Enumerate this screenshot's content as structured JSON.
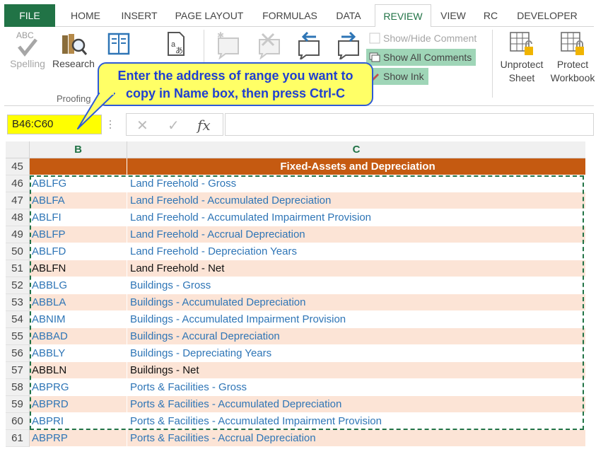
{
  "tabs": [
    {
      "label": "FILE",
      "x": 0
    },
    {
      "label": "HOME"
    },
    {
      "label": "INSERT"
    },
    {
      "label": "PAGE LAYOUT"
    },
    {
      "label": "FORMULAS"
    },
    {
      "label": "DATA"
    },
    {
      "label": "REVIEW"
    },
    {
      "label": "VIEW"
    },
    {
      "label": "RC"
    },
    {
      "label": "DEVELOPER"
    }
  ],
  "ribbon": {
    "spelling_label": "Spelling",
    "research_label": "Research",
    "proofing_group": "Proofing",
    "show_hide_comment": "Show/Hide Comment",
    "show_all_comments": "Show All Comments",
    "show_ink": "Show Ink",
    "unprotect_sheet_line1": "Unprotect",
    "unprotect_sheet_line2": "Sheet",
    "protect_workbook_line1": "Protect",
    "protect_workbook_line2": "Workbook",
    "abc_glyph": "ABC"
  },
  "callout": {
    "line1": "Enter the address of range you want to",
    "line2": "copy in Name box, then press Ctrl-C"
  },
  "formula_bar": {
    "name_box": "B46:C60",
    "fx": "fx",
    "cancel": "✕",
    "enter": "✓"
  },
  "columns": {
    "b": "B",
    "c": "C"
  },
  "rows": [
    {
      "num": "45",
      "b": "",
      "c": "Fixed-Assets and Depreciation",
      "style": "header"
    },
    {
      "num": "46",
      "b": "ABLFG",
      "c": "Land Freehold - Gross",
      "color": "blue"
    },
    {
      "num": "47",
      "b": "ABLFA",
      "c": "Land Freehold - Accumulated Depreciation",
      "color": "blue"
    },
    {
      "num": "48",
      "b": "ABLFI",
      "c": "Land Freehold - Accumulated Impairment Provision",
      "color": "blue"
    },
    {
      "num": "49",
      "b": "ABLFP",
      "c": "Land Freehold - Accrual Depreciation",
      "color": "blue"
    },
    {
      "num": "50",
      "b": "ABLFD",
      "c": "Land Freehold - Depreciation Years",
      "color": "blue"
    },
    {
      "num": "51",
      "b": "ABLFN",
      "c": "Land Freehold - Net",
      "color": "black"
    },
    {
      "num": "52",
      "b": "ABBLG",
      "c": "Buildings - Gross",
      "color": "blue"
    },
    {
      "num": "53",
      "b": "ABBLA",
      "c": "Buildings - Accumulated Depreciation",
      "color": "blue"
    },
    {
      "num": "54",
      "b": "ABNIM",
      "c": "Buildings - Accumulated Impairment Provision",
      "color": "blue"
    },
    {
      "num": "55",
      "b": "ABBAD",
      "c": "Buildings - Accural Depreciation",
      "color": "blue"
    },
    {
      "num": "56",
      "b": "ABBLY",
      "c": "Buildings - Depreciating Years",
      "color": "blue"
    },
    {
      "num": "57",
      "b": "ABBLN",
      "c": "Buildings - Net",
      "color": "black"
    },
    {
      "num": "58",
      "b": "ABPRG",
      "c": "Ports & Facilities - Gross",
      "color": "blue"
    },
    {
      "num": "59",
      "b": "ABPRD",
      "c": "Ports & Facilities - Accumulated Depreciation",
      "color": "blue"
    },
    {
      "num": "60",
      "b": "ABPRI",
      "c": "Ports & Facilities - Accumulated Impairment Provision",
      "color": "blue"
    },
    {
      "num": "61",
      "b": "ABPRP",
      "c": "Ports & Facilities - Accrual Depreciation",
      "color": "blue"
    }
  ],
  "colors": {
    "excel_green": "#217346",
    "header_orange": "#c55a11",
    "band_peach": "#fce4d6",
    "link_blue": "#2e75b6",
    "namebox_yellow": "#ffff00",
    "callout_yellow": "#ffff66",
    "callout_border": "#2e5ad6"
  }
}
